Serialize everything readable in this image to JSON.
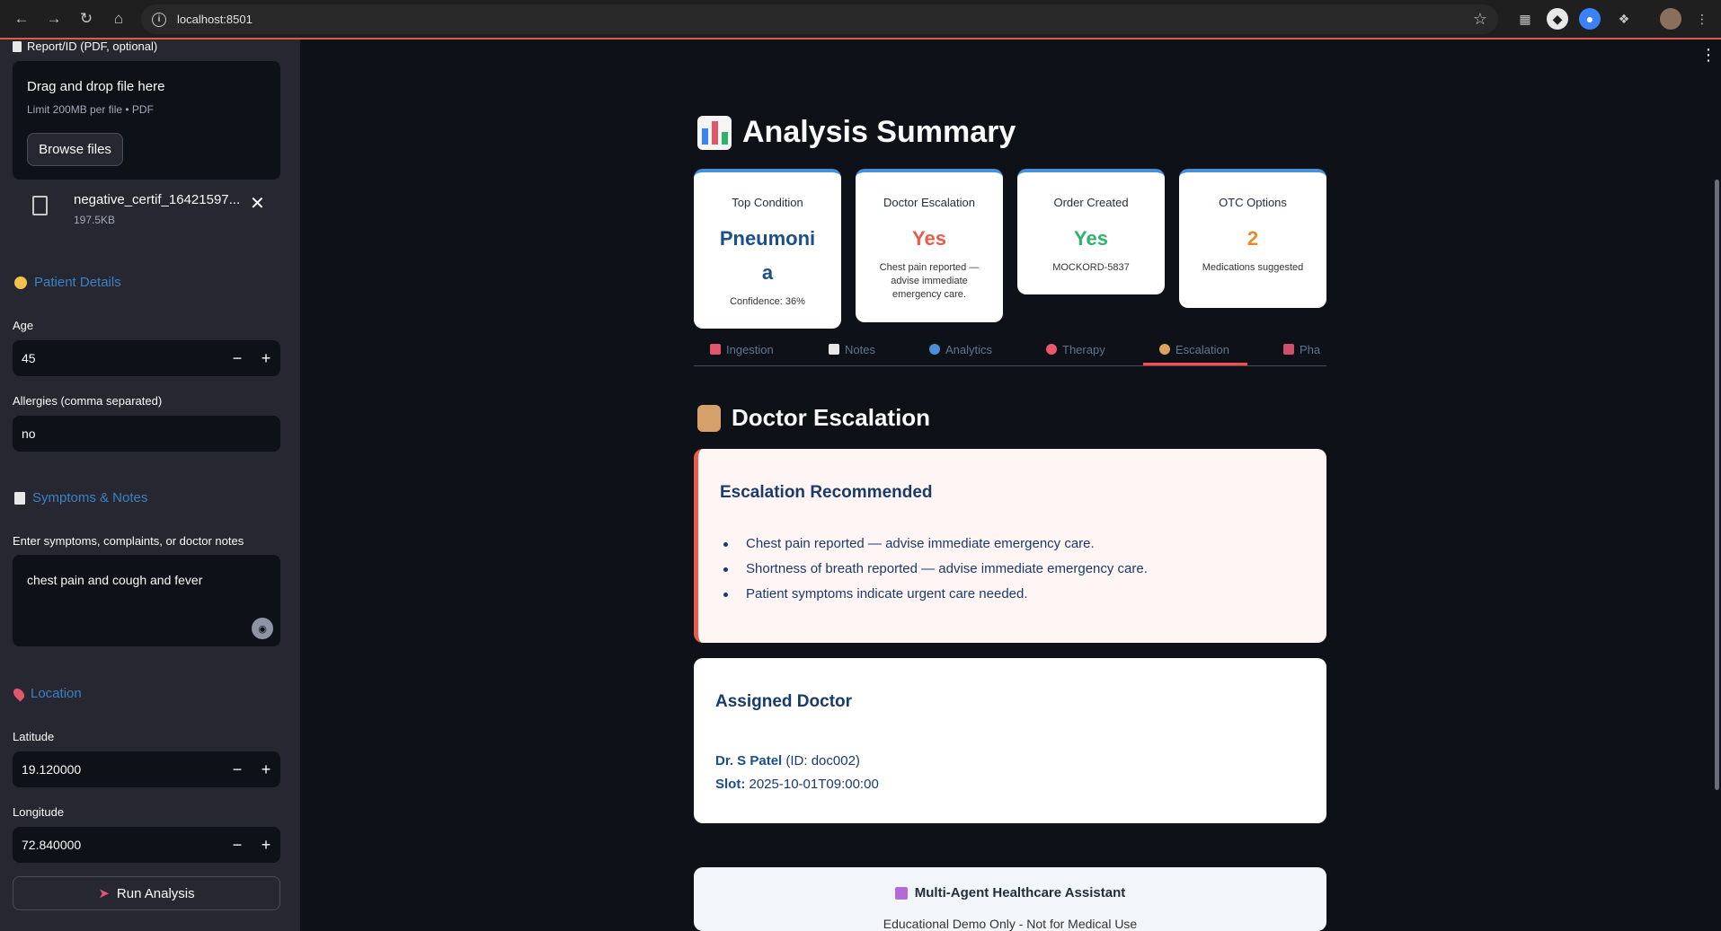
{
  "browser": {
    "url": "localhost:8501"
  },
  "sidebar": {
    "report_label": "Report/ID (PDF, optional)",
    "uploader": {
      "drag_text": "Drag and drop file here",
      "limit_text": "Limit 200MB per file • PDF",
      "browse_label": "Browse files"
    },
    "file": {
      "name": "negative_certif_16421597...",
      "size": "197.5KB"
    },
    "patient_header": "Patient Details",
    "age_label": "Age",
    "age_value": "45",
    "allergies_label": "Allergies (comma separated)",
    "allergies_value": "no",
    "symptoms_header": "Symptoms & Notes",
    "symptoms_label": "Enter symptoms, complaints, or doctor notes",
    "symptoms_value": "chest pain and cough and fever",
    "location_header": "Location",
    "latitude_label": "Latitude",
    "latitude_value": "19.120000",
    "longitude_label": "Longitude",
    "longitude_value": "72.840000",
    "run_label": "Run Analysis"
  },
  "main": {
    "title": "Analysis Summary",
    "metrics": [
      {
        "label": "Top Condition",
        "value": "Pneumoni a",
        "sub": "Confidence: 36%",
        "color": "#1a4f8c"
      },
      {
        "label": "Doctor Escalation",
        "value": "Yes",
        "sub": "Chest pain reported — advise immediate emergency care.",
        "color": "#e85d4a"
      },
      {
        "label": "Order Created",
        "value": "Yes",
        "sub": "MOCKORD-5837",
        "color": "#2fb36b"
      },
      {
        "label": "OTC Options",
        "value": "2",
        "sub": "Medications suggested",
        "color": "#e88a2a"
      }
    ],
    "tabs": [
      {
        "label": "Ingestion",
        "color": "#e0566b"
      },
      {
        "label": "Notes",
        "color": "#e8e8e8"
      },
      {
        "label": "Analytics",
        "color": "#4a8fd6"
      },
      {
        "label": "Therapy",
        "color": "#e8596b"
      },
      {
        "label": "Escalation",
        "color": "#e0a15a"
      },
      {
        "label": "Pha",
        "color": "#d0506b"
      }
    ],
    "active_tab": "Escalation",
    "section_title": "Doctor Escalation",
    "alert": {
      "title": "Escalation Recommended",
      "items": [
        "Chest pain reported — advise immediate emergency care.",
        "Shortness of breath reported — advise immediate emergency care.",
        "Patient symptoms indicate urgent care needed."
      ]
    },
    "doctor": {
      "title": "Assigned Doctor",
      "name": "Dr. S Patel",
      "id_text": "(ID: doc002)",
      "slot_label": "Slot:",
      "slot_value": "2025-10-01T09:00:00"
    },
    "footer": {
      "title": "Multi-Agent Healthcare Assistant",
      "subtitle": "Educational Demo Only - Not for Medical Use"
    }
  }
}
